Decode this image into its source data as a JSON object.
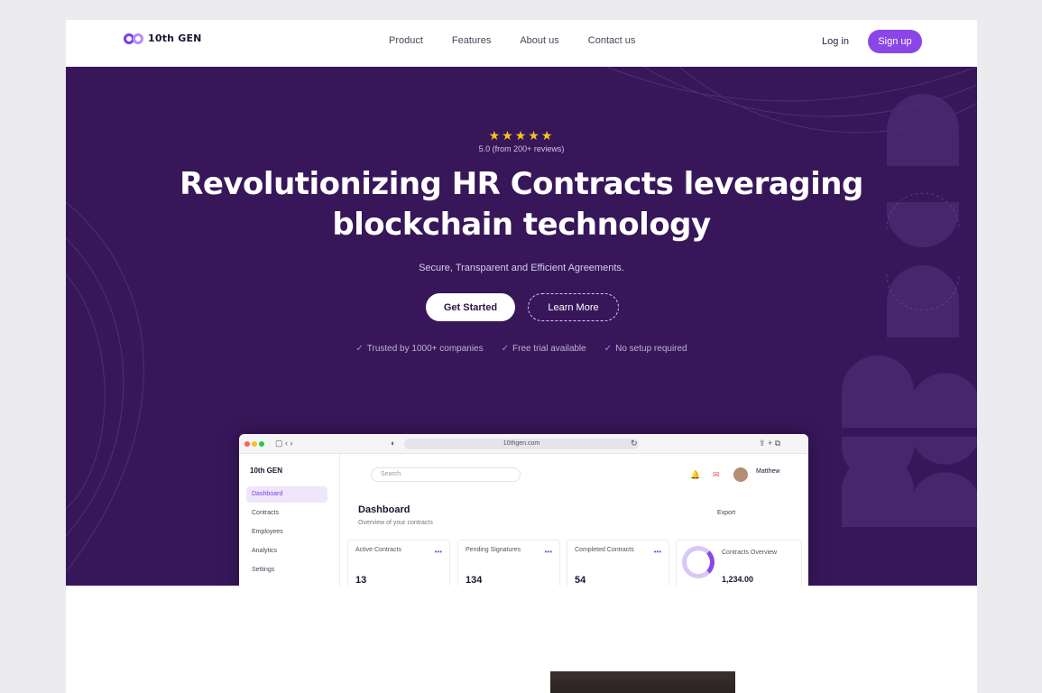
{
  "brand": {
    "name": "10th GEN",
    "accent": "#8a46e6",
    "hero_bg": "#37175a"
  },
  "nav": {
    "links": [
      "Product",
      "Features",
      "About us",
      "Contact us"
    ],
    "login": "Log in",
    "signup": "Sign up"
  },
  "hero": {
    "stars": "★★★★★",
    "rating": "5.0 (from 200+ reviews)",
    "title_line1": "Revolutionizing HR Contracts leveraging",
    "title_line2": "blockchain technology",
    "subtitle": "Secure, Transparent and Efficient Agreements.",
    "cta_primary": "Get Started",
    "cta_secondary": "Learn More",
    "checks": [
      "Trusted by 1000+ companies",
      "Free trial available",
      "No setup required"
    ]
  },
  "app_preview": {
    "url": "10thgen.com",
    "sidebar_brand": "10th GEN",
    "sidebar_items": [
      "Dashboard",
      "Contracts",
      "Employees",
      "Analytics",
      "Settings"
    ],
    "search_placeholder": "Search",
    "profile_name": "Matthew",
    "dashboard_title": "Dashboard",
    "dashboard_subtitle": "Overview of your contracts",
    "export_label": "Export",
    "cards": [
      {
        "label": "Active Contracts",
        "value": "13"
      },
      {
        "label": "Pending Signatures",
        "value": "134"
      },
      {
        "label": "Completed Contracts",
        "value": "54"
      }
    ],
    "stack": {
      "label": "Contracts Overview",
      "value": "1,234.00"
    }
  }
}
